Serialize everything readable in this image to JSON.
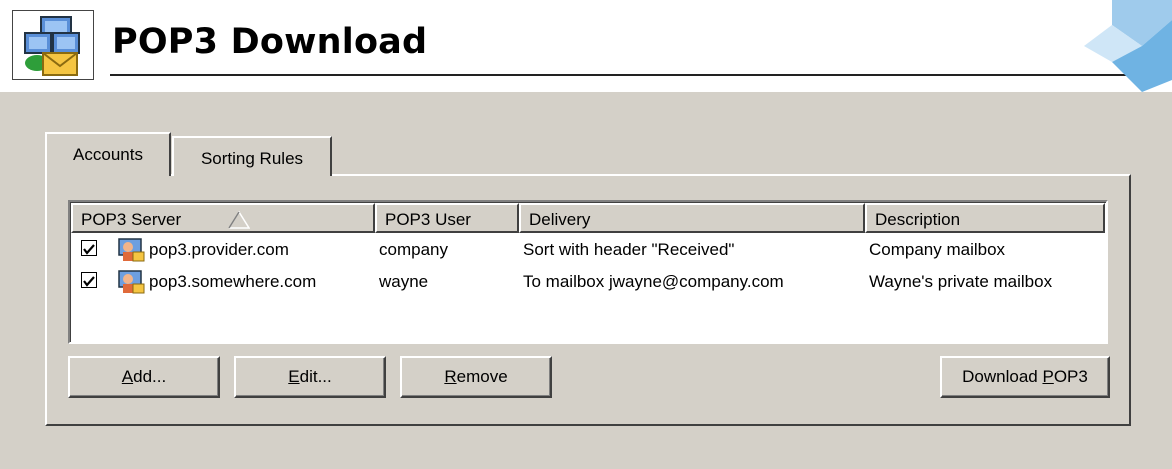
{
  "header": {
    "title": "POP3 Download"
  },
  "tabs": [
    {
      "label": "Accounts",
      "active": true
    },
    {
      "label": "Sorting Rules",
      "active": false
    }
  ],
  "table": {
    "columns": [
      "POP3 Server",
      "POP3 User",
      "Delivery",
      "Description"
    ],
    "sort_indicator": "sort-ascending-icon",
    "rows": [
      {
        "checked": true,
        "server": "pop3.provider.com",
        "user": "company",
        "delivery": "Sort with header \"Received\"",
        "description": "Company mailbox"
      },
      {
        "checked": true,
        "server": "pop3.somewhere.com",
        "user": "wayne",
        "delivery": "To mailbox jwayne@company.com",
        "description": "Wayne's private mailbox"
      }
    ]
  },
  "buttons": {
    "add": {
      "mnemonic": "A",
      "rest": "dd..."
    },
    "edit": {
      "mnemonic": "E",
      "rest": "dit..."
    },
    "remove": {
      "mnemonic": "R",
      "rest": "emove"
    },
    "download": {
      "prefix": "Download ",
      "mnemonic": "P",
      "rest": "OP3"
    }
  },
  "colors": {
    "dialog_bg": "#d4d0c8",
    "list_bg": "#ffffff",
    "header_bg": "#ffffff"
  }
}
